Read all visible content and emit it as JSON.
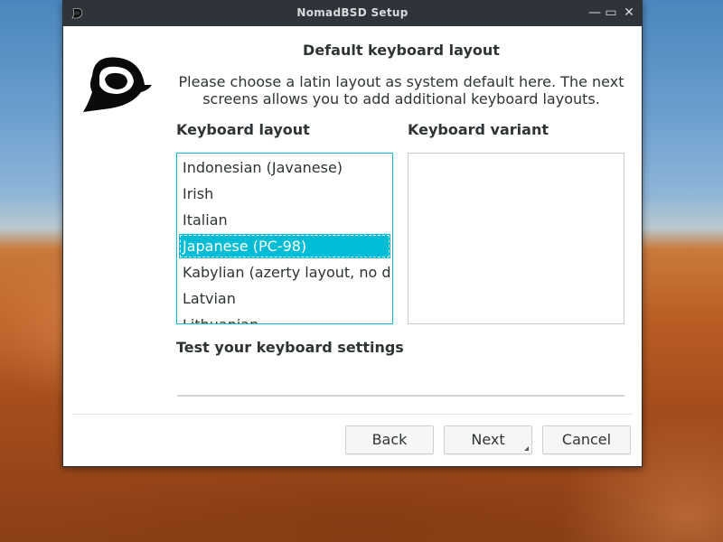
{
  "window": {
    "title": "NomadBSD Setup",
    "buttons": {
      "minimize": "—",
      "maximize": "▭",
      "close": "✕"
    }
  },
  "page": {
    "heading": "Default keyboard layout",
    "intro": "Please choose a latin layout as system default here. The next screens allows you to add additional keyboard layouts."
  },
  "layout_label": "Keyboard layout",
  "variant_label": "Keyboard variant",
  "layouts": [
    {
      "label": "Indonesian (Javanese)",
      "selected": false
    },
    {
      "label": "Irish",
      "selected": false
    },
    {
      "label": "Italian",
      "selected": false
    },
    {
      "label": "Japanese (PC-98)",
      "selected": true
    },
    {
      "label": "Kabylian (azerty layout, no dead keys)",
      "selected": false
    },
    {
      "label": "Latvian",
      "selected": false
    },
    {
      "label": "Lithuanian",
      "selected": false
    }
  ],
  "variants": [],
  "test_label": "Test your keyboard settings",
  "test_input_value": "",
  "actions": {
    "back": "Back",
    "next": "Next",
    "cancel": "Cancel"
  },
  "colors": {
    "accent": "#00bcd4",
    "titlebar": "#2f343a"
  }
}
